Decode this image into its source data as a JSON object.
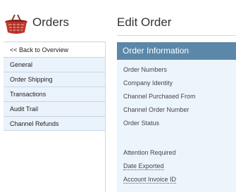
{
  "app": {
    "title": "Orders"
  },
  "page": {
    "title": "Edit Order"
  },
  "sidebar": {
    "back_label": "<< Back to Overview",
    "items": [
      {
        "label": "General"
      },
      {
        "label": "Order Shipping"
      },
      {
        "label": "Transactions"
      },
      {
        "label": "Audit Trail"
      },
      {
        "label": "Channel Refunds"
      }
    ]
  },
  "panel": {
    "title": "Order Information",
    "fields": [
      {
        "label": "Order Numbers"
      },
      {
        "label": "Company Identity"
      },
      {
        "label": "Channel Purchased From"
      },
      {
        "label": "Channel Order Number"
      },
      {
        "label": "Order Status"
      },
      {
        "label": "Attention Required"
      },
      {
        "label": "Date Exported"
      },
      {
        "label": "Account Invoice ID"
      }
    ]
  },
  "colors": {
    "panel_header": "#5b87a8",
    "panel_bg": "#edf5fc",
    "nav_bg": "#eaf3fb",
    "basket": "#c0392b"
  },
  "icons": {
    "app_icon": "shopping-basket-icon"
  }
}
